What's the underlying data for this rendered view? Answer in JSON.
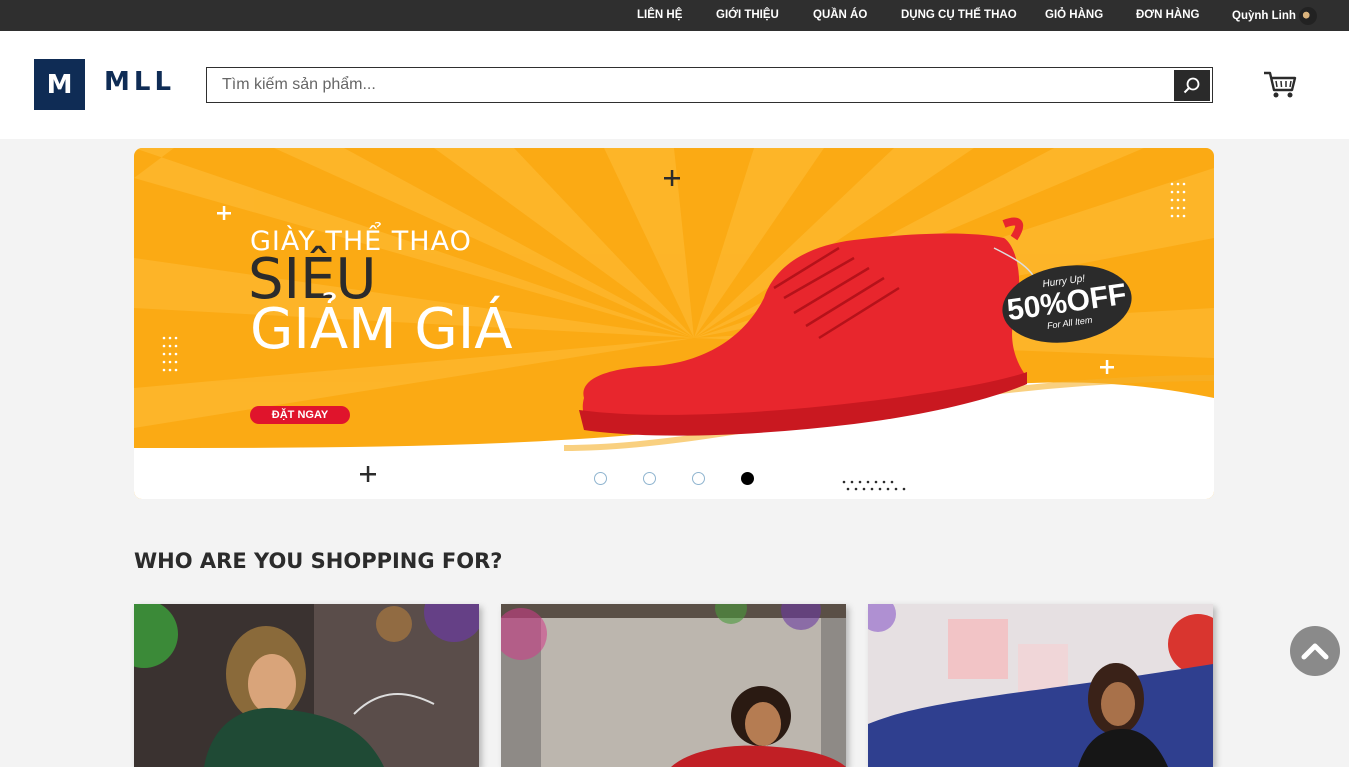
{
  "topnav": {
    "items": [
      "LIÊN HỆ",
      "GIỚI THIỆU",
      "QUẦN ÁO",
      "DỤNG CỤ THỂ THAO",
      "GIỎ HÀNG",
      "ĐƠN HÀNG"
    ],
    "user_name": "Quỳnh Linh"
  },
  "header": {
    "logo_letter": "M",
    "logo_text": "MLL",
    "search_placeholder": "Tìm kiếm sản phẩm..."
  },
  "banner": {
    "line1": "GIÀY THỂ THAO",
    "line2": "SIÊU",
    "line3": "GIẢM GIÁ",
    "cta": "ĐẶT NGAY",
    "badge_top": "Hurry Up!",
    "badge_main": "50%OFF",
    "badge_bottom": "For All Item",
    "slides_count": 4,
    "active_slide": 4
  },
  "section": {
    "title": "WHO ARE YOU SHOPPING FOR?"
  },
  "colors": {
    "topbar": "#2f2f2f",
    "brand": "#0f2c55",
    "banner_orange": "#fbaa14",
    "shoe_red": "#e8262d",
    "cta_red": "#e0142c"
  }
}
